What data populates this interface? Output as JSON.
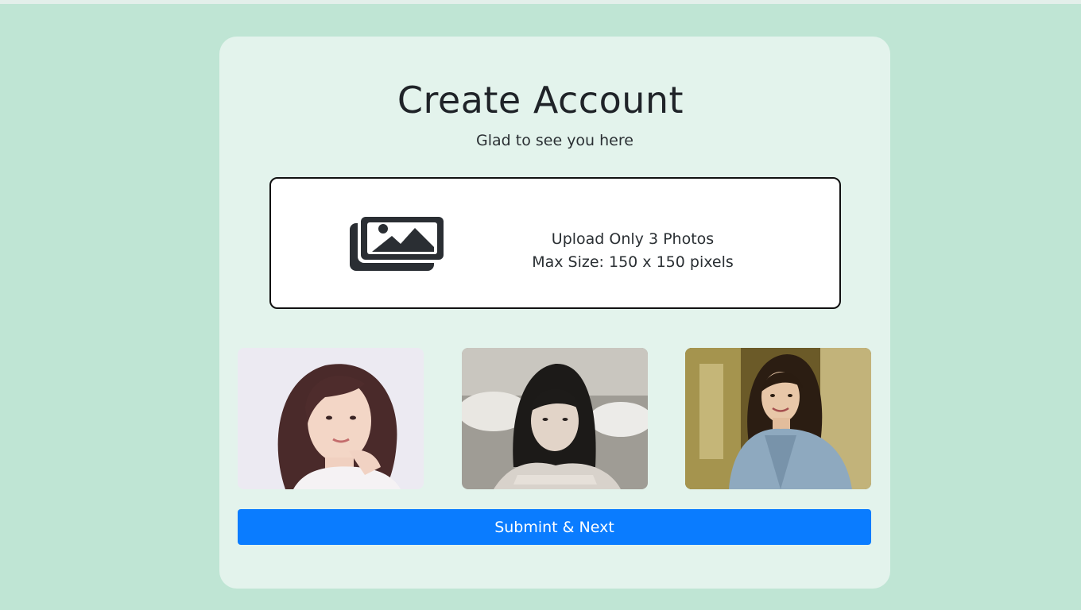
{
  "header": {
    "title": "Create Account",
    "subtitle": "Glad to see you here"
  },
  "upload": {
    "icon": "images-icon",
    "line1": "Upload Only 3 Photos",
    "line2": "Max Size: 150 x 150 pixels"
  },
  "photos": [
    {
      "name": "uploaded-photo-1"
    },
    {
      "name": "uploaded-photo-2"
    },
    {
      "name": "uploaded-photo-3"
    }
  ],
  "actions": {
    "submit_label": "Submint & Next"
  },
  "colors": {
    "page_background": "#bfe5d4",
    "card_background": "#e3f3ec",
    "button": "#0a7cff"
  }
}
